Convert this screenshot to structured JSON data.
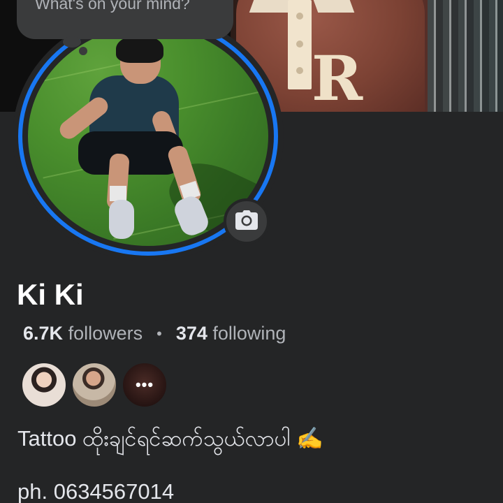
{
  "composer": {
    "placeholder": "What's on your mind?"
  },
  "profile": {
    "name": "Ki Ki",
    "followers_count": "6.7K",
    "followers_label": "followers",
    "separator": "•",
    "following_count": "374",
    "following_label": "following",
    "mutual_more": "•••",
    "bio": "Tattoo ထိုးချင်ရင်ဆက်သွယ်လာပါ ✍️",
    "phone": "ph. 0634567014"
  },
  "icons": {
    "camera": "camera-icon",
    "more": "more-dots-icon"
  },
  "colors": {
    "background": "#242526",
    "story_ring": "#1877f2",
    "primary_text": "#e4e6eb",
    "secondary_text": "#b0b3b8",
    "button_bg": "#3a3b3c"
  }
}
